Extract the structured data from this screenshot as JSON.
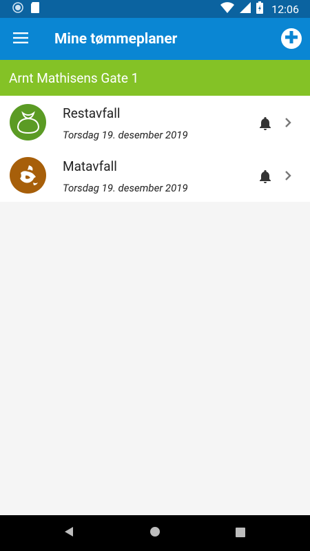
{
  "status_bar": {
    "time": "12:06",
    "icons": [
      "status-circle-icon",
      "sd-card-icon",
      "wifi-icon",
      "signal-icon",
      "battery-charging-icon"
    ]
  },
  "app_bar": {
    "title": "Mine tømmeplaner",
    "menu_icon": "hamburger-menu-icon",
    "add_icon": "add-circle-icon"
  },
  "address": {
    "label": "Arnt Mathisens Gate 1"
  },
  "schedules": [
    {
      "title": "Restavfall",
      "date": "Torsdag 19. desember 2019",
      "icon": "trash-bag-icon",
      "color": "#5b9b24"
    },
    {
      "title": "Matavfall",
      "date": "Torsdag 19. desember 2019",
      "icon": "food-waste-icon",
      "color": "#a75f0a"
    }
  ],
  "colors": {
    "status_bar": "#0b63a0",
    "app_bar": "#0a86d3",
    "address_bar": "#84c226",
    "background": "#f5f5f5"
  },
  "nav_bar": {
    "buttons": [
      "back-icon",
      "home-icon",
      "recents-icon"
    ]
  }
}
